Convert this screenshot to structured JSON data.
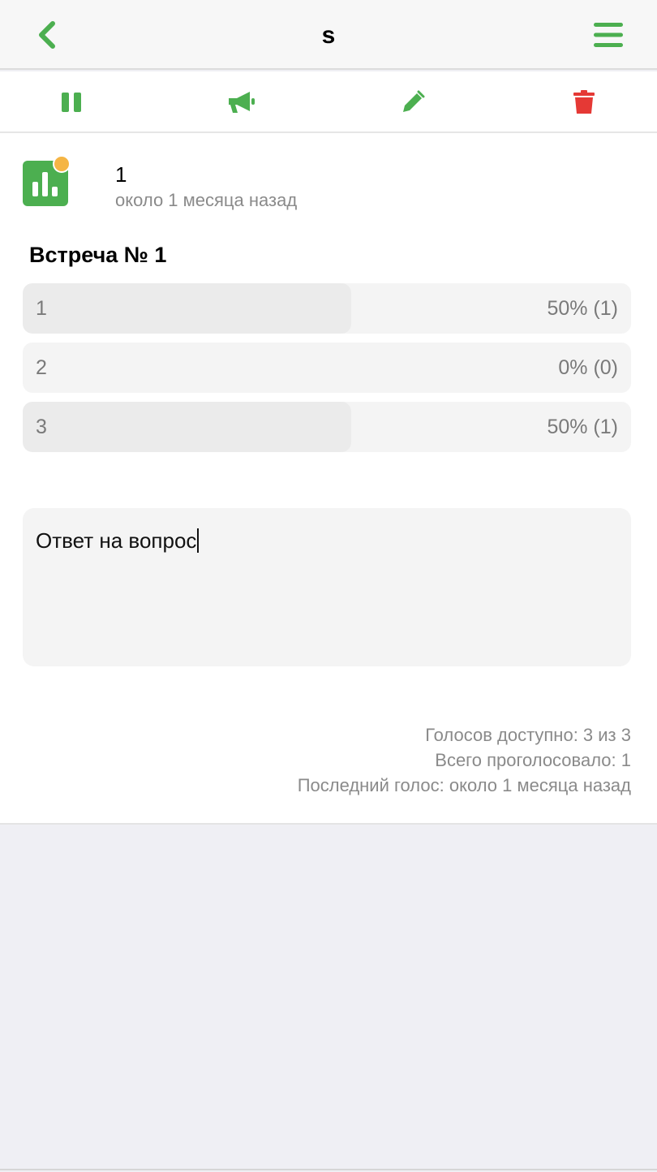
{
  "navbar": {
    "title": "s",
    "back_icon": "chevron-left-icon",
    "menu_icon": "hamburger-menu-icon",
    "accent_color": "#4caf50"
  },
  "toolbar": {
    "items": [
      {
        "icon": "pause-icon",
        "color": "#4caf50"
      },
      {
        "icon": "megaphone-icon",
        "color": "#4caf50"
      },
      {
        "icon": "pencil-icon",
        "color": "#4caf50"
      },
      {
        "icon": "trash-icon",
        "color": "#e53935"
      }
    ]
  },
  "poll": {
    "icon": "poll-chart-icon",
    "status_dot_color": "#f5b544",
    "author": "1",
    "time": "около 1 месяца назад",
    "question": "Встреча № 1",
    "options": [
      {
        "label": "1",
        "result": "50% (1)",
        "share": 0.5
      },
      {
        "label": "2",
        "result": "0% (0)",
        "share": 0
      },
      {
        "label": "3",
        "result": "50% (1)",
        "share": 0.5
      }
    ],
    "answer_value": "Ответ на вопрос"
  },
  "stats": {
    "votes_available": "Голосов доступно: 3 из 3",
    "total_voted": "Всего проголосовало: 1",
    "last_vote": "Последний голос: около 1 месяца назад"
  }
}
